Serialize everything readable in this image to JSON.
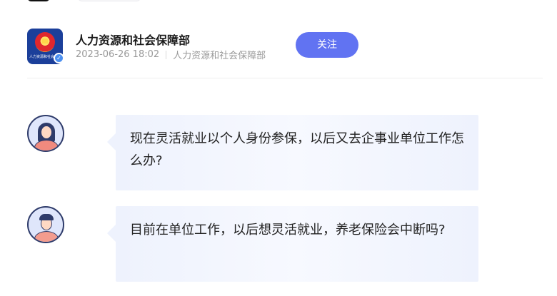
{
  "header": {
    "logo_text": "人力资源和社会保障部",
    "account_name": "人力资源和社会保障部",
    "publish_time": "2023-06-26 18:02",
    "source": "人力资源和社会保障部",
    "follow_label": "关注"
  },
  "qa_list": [
    {
      "avatar": "woman-avatar-icon",
      "question": "现在灵活就业以个人身份参保，以后又去企事业单位工作怎么办?"
    },
    {
      "avatar": "man-avatar-icon",
      "question": "目前在单位工作，以后想灵活就业，养老保险会中断吗?"
    }
  ],
  "colors": {
    "accent": "#6173f2",
    "bubble_bg": "#eef2fd",
    "avatar_outline": "#2e3b6a"
  }
}
